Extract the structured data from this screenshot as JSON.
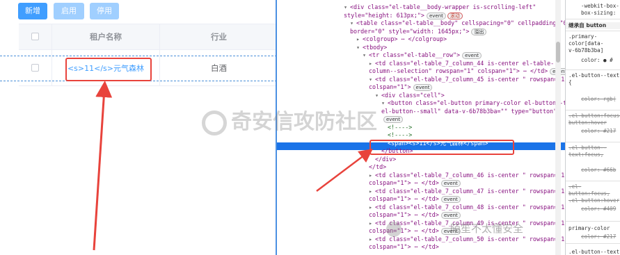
{
  "toolbar": {
    "new_label": "新增",
    "enable_label": "启用",
    "disable_label": "停用"
  },
  "table": {
    "headers": [
      "",
      "租户名称",
      "行业"
    ],
    "rows": [
      {
        "name": "<s>11</s>元气森林",
        "industry": "白酒"
      }
    ]
  },
  "devtools": {
    "lines": [
      {
        "i": 0,
        "t": "▾",
        "h": "<div class=\"el-table__body-wrapper is-scrolling-left\"",
        "b": ""
      },
      {
        "i": 0,
        "t": "",
        "h": "style=\"height: 613px;\">",
        "b": "event",
        "b2": "滚动"
      },
      {
        "i": 1,
        "t": "▾",
        "h": "<table class=\"el-table__body\" cellspacing=\"0\" cellpadding=\"0\"",
        "b": ""
      },
      {
        "i": 1,
        "t": "",
        "h": "border=\"0\" style=\"width: 1645px;\">",
        "b": "溢出"
      },
      {
        "i": 2,
        "t": "▸",
        "h": "<colgroup> ⋯ </colgroup>",
        "b": ""
      },
      {
        "i": 2,
        "t": "▾",
        "h": "<tbody>",
        "b": ""
      },
      {
        "i": 3,
        "t": "▾",
        "h": "<tr class=\"el-table__row\">",
        "b": "event"
      },
      {
        "i": 4,
        "t": "▸",
        "h": "<td class=\"el-table_7_column_44 is-center el-table-",
        "b": ""
      },
      {
        "i": 4,
        "t": "",
        "h": "column--selection\" rowspan=\"1\" colspan=\"1\"> ⋯ </td>",
        "b": "event"
      },
      {
        "i": 4,
        "t": "▾",
        "h": "<td class=\"el-table_7_column_45 is-center \" rowspan=\"1\"",
        "b": ""
      },
      {
        "i": 4,
        "t": "",
        "h": "colspan=\"1\">",
        "b": "event"
      },
      {
        "i": 5,
        "t": "▾",
        "h": "<div class=\"cell\">",
        "b": ""
      },
      {
        "i": 6,
        "t": "▾",
        "h": "<button class=\"el-button primary-color el-button--text",
        "b": ""
      },
      {
        "i": 6,
        "t": "",
        "h": "el-button--small\" data-v-6b78b3ba=\"\" type=\"button\">",
        "b": ""
      },
      {
        "i": 6,
        "t": "",
        "h": "",
        "b": "event"
      },
      {
        "i": 7,
        "t": "",
        "h": "<!---->",
        "b": "",
        "c": true
      },
      {
        "i": 7,
        "t": "",
        "h": "<!---->",
        "b": "",
        "c": true
      },
      {
        "i": 7,
        "t": "",
        "h": "<span><s>11</s>元气森林</span>",
        "b": "",
        "sel": true
      },
      {
        "i": 6,
        "t": "",
        "h": "</button>",
        "b": ""
      },
      {
        "i": 5,
        "t": "",
        "h": "</div>",
        "b": ""
      },
      {
        "i": 4,
        "t": "",
        "h": "</td>",
        "b": ""
      },
      {
        "i": 4,
        "t": "▸",
        "h": "<td class=\"el-table_7_column_46 is-center \" rowspan=\"1\"",
        "b": ""
      },
      {
        "i": 4,
        "t": "",
        "h": "colspan=\"1\"> ⋯ </td>",
        "b": "event"
      },
      {
        "i": 4,
        "t": "▸",
        "h": "<td class=\"el-table_7_column_47 is-center \" rowspan=\"1\"",
        "b": ""
      },
      {
        "i": 4,
        "t": "",
        "h": "colspan=\"1\"> ⋯ </td>",
        "b": "event"
      },
      {
        "i": 4,
        "t": "▸",
        "h": "<td class=\"el-table_7_column_48 is-center \" rowspan=\"1\"",
        "b": ""
      },
      {
        "i": 4,
        "t": "",
        "h": "colspan=\"1\"> ⋯ </td>",
        "b": "event"
      },
      {
        "i": 4,
        "t": "▸",
        "h": "<td class=\"el-table_7_column_49 is-center \" rowspan=\"1\"",
        "b": ""
      },
      {
        "i": 4,
        "t": "",
        "h": "colspan=\"1\"> ⋯ </td>",
        "b": "event"
      },
      {
        "i": 4,
        "t": "▸",
        "h": "<td class=\"el-table_7_column_50 is-center \" rowspan=\"1\"",
        "b": ""
      },
      {
        "i": 4,
        "t": "",
        "h": "colspan=\"1\"> ⋯ </td>",
        "b": ""
      }
    ]
  },
  "styles_pane": {
    "lines": [
      "-webkit-box-",
      "box-sizing:",
      "继承自 button",
      ".primary-",
      "color[data-",
      "v-6b78b3ba]",
      "color: ● #",
      ".el-button--text",
      "{",
      "color: rgb(",
      ".el-button:focus,",
      "button:hover",
      "color: #217",
      ".el-button--",
      "text:focus,",
      "color: #66b",
      ".el-",
      "button:focus,",
      ".el-button:hover",
      "color: #409",
      "primary-color",
      "color: #217",
      ".el-button--text"
    ]
  },
  "watermarks": {
    "main": "奇安信攻防社区",
    "secondary": "陌笙不太懂安全"
  },
  "colors": {
    "primary": "#409eff",
    "primary_disabled": "#a0cfff",
    "highlight_red": "#e8433c",
    "devtools_selection": "#1a73e8"
  }
}
